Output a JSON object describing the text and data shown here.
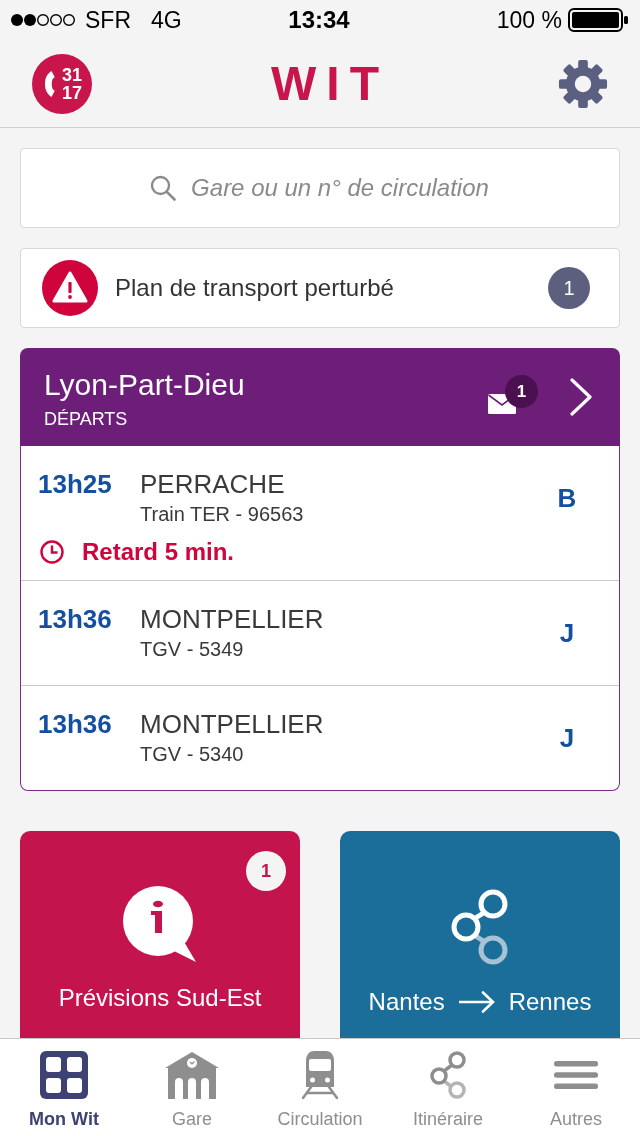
{
  "status_bar": {
    "carrier": "SFR",
    "network": "4G",
    "time": "13:34",
    "battery": "100 %"
  },
  "header": {
    "hotline": [
      "31",
      "17"
    ],
    "title": "WIT"
  },
  "search": {
    "placeholder": "Gare ou un n° de circulation"
  },
  "alert": {
    "text": "Plan de transport perturbé",
    "count": "1"
  },
  "station": {
    "name": "Lyon-Part-Dieu",
    "board": "DÉPARTS",
    "messages": "1",
    "departures": [
      {
        "time": "13h25",
        "destination": "PERRACHE",
        "train": "Train TER - 96563",
        "platform": "B",
        "delay": "Retard 5 min."
      },
      {
        "time": "13h36",
        "destination": "MONTPELLIER",
        "train": "TGV - 5349",
        "platform": "J"
      },
      {
        "time": "13h36",
        "destination": "MONTPELLIER",
        "train": "TGV - 5340",
        "platform": "J"
      }
    ]
  },
  "tiles": [
    {
      "kind": "forecast",
      "label": "Prévisions Sud-Est",
      "badge": "1"
    },
    {
      "kind": "route",
      "from": "Nantes",
      "to": "Rennes"
    }
  ],
  "tab_bar": [
    {
      "label": "Mon Wit",
      "selected": true
    },
    {
      "label": "Gare",
      "selected": false
    },
    {
      "label": "Circulation",
      "selected": false
    },
    {
      "label": "Itinéraire",
      "selected": false
    },
    {
      "label": "Autres",
      "selected": false
    }
  ]
}
